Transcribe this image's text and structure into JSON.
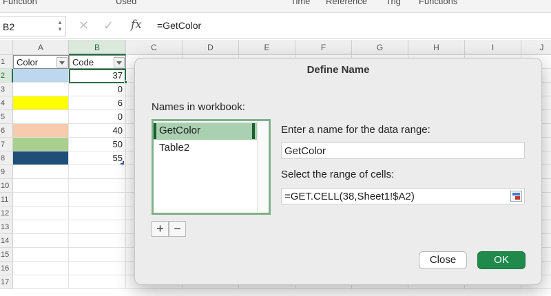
{
  "ribbon": {
    "items": [
      "Function",
      "Used",
      "Time",
      "Reference",
      "Trig",
      "Functions"
    ]
  },
  "formula_bar": {
    "cell_ref": "B2",
    "cancel_glyph": "✕",
    "enter_glyph": "✓",
    "fx_label": "fx",
    "formula": "=GetColor"
  },
  "sheet": {
    "columns": [
      "A",
      "B",
      "C",
      "D",
      "E",
      "F",
      "G",
      "H",
      "I",
      "J"
    ],
    "rows": [
      "1",
      "2",
      "3",
      "4",
      "5",
      "6",
      "7",
      "8",
      "9",
      "10",
      "11",
      "12",
      "13",
      "14",
      "15",
      "16",
      "17"
    ],
    "header_a": "Color",
    "header_b": "Code",
    "values": [
      "37",
      "0",
      "6",
      "0",
      "40",
      "50",
      "55"
    ],
    "fill_colors": [
      "#bdd7ee",
      "#ffffff",
      "#ffff00",
      "#ffffff",
      "#f8cbad",
      "#a9d08e",
      "#1f4e78"
    ]
  },
  "dialog": {
    "title": "Define Name",
    "names_label": "Names in workbook:",
    "names": [
      "GetColor",
      "Table2"
    ],
    "add_label": "+",
    "remove_label": "−",
    "name_prompt": "Enter a name for the data range:",
    "name_value": "GetColor",
    "range_prompt": "Select the range of cells:",
    "range_value": "=GET.CELL(38,Sheet1!$A2)",
    "close_label": "Close",
    "ok_label": "OK"
  },
  "colors": {
    "accent": "#217346",
    "ok_button": "#1f8a4b",
    "list_selection": "#a9d0b0"
  },
  "icons": [
    "cancel-icon",
    "enter-icon",
    "fx-icon",
    "collapse-dialog-icon",
    "filter-dropdown-icon"
  ]
}
